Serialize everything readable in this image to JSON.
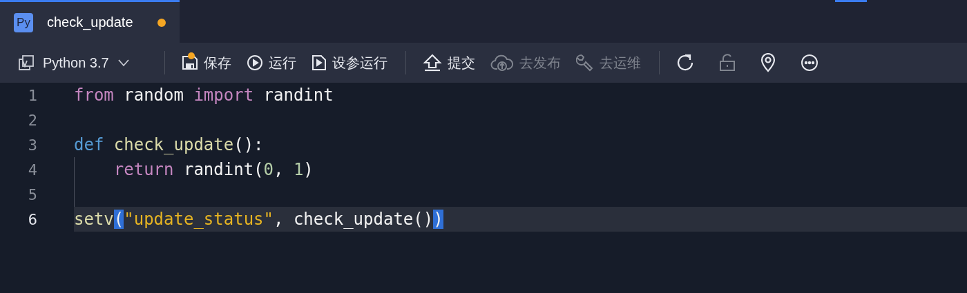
{
  "tabs": [
    {
      "badge": "Py",
      "label": "check_update",
      "selected": true,
      "modified": true
    }
  ],
  "toolbar": [
    {
      "kind": "select",
      "label": "Python 3.7"
    },
    {
      "kind": "divider"
    },
    {
      "kind": "button",
      "label": "保存",
      "disabled": false,
      "dot": true
    },
    {
      "kind": "button",
      "label": "运行",
      "disabled": false,
      "dot": false
    },
    {
      "kind": "button",
      "label": "设参运行",
      "disabled": false,
      "dot": false
    },
    {
      "kind": "divider"
    },
    {
      "kind": "button",
      "label": "提交",
      "disabled": false,
      "dot": false
    },
    {
      "kind": "button",
      "label": "去发布",
      "disabled": true,
      "dot": false
    },
    {
      "kind": "button",
      "label": "去运维",
      "disabled": true,
      "dot": false
    },
    {
      "kind": "divider"
    },
    {
      "kind": "icon",
      "disabled": false
    },
    {
      "kind": "icon",
      "disabled": true
    },
    {
      "kind": "icon",
      "disabled": false
    },
    {
      "kind": "icon",
      "disabled": false
    }
  ],
  "editor": {
    "lines": [
      {
        "number": "1",
        "current": false,
        "tokens": [
          {
            "text": "from",
            "kind": "keyword"
          },
          {
            "text": " random ",
            "kind": "plain"
          },
          {
            "text": "import",
            "kind": "keyword"
          },
          {
            "text": " randint",
            "kind": "plain"
          }
        ]
      },
      {
        "number": "2",
        "current": false
      },
      {
        "number": "3",
        "current": false,
        "tokens": [
          {
            "text": "def ",
            "kind": "def"
          },
          {
            "text": "check_update",
            "kind": "function"
          },
          {
            "text": "():",
            "kind": "plain"
          }
        ]
      },
      {
        "number": "4",
        "current": false,
        "tokens": [
          {
            "text": "    return",
            "kind": "keyword"
          },
          {
            "text": " randint(",
            "kind": "plain"
          },
          {
            "text": "0",
            "kind": "number"
          },
          {
            "text": ", ",
            "kind": "plain"
          },
          {
            "text": "1",
            "kind": "number"
          },
          {
            "text": ")",
            "kind": "plain"
          }
        ]
      },
      {
        "number": "5",
        "current": false
      },
      {
        "number": "6",
        "current": true,
        "tokens": [
          {
            "text": "setv",
            "kind": "function"
          },
          {
            "text": "(",
            "kind": "plain",
            "matched": true
          },
          {
            "text": "\"update_status\"",
            "kind": "string"
          },
          {
            "text": ", check_update()",
            "kind": "plain"
          },
          {
            "text": ")",
            "kind": "plain",
            "matched": true
          }
        ]
      }
    ]
  }
}
